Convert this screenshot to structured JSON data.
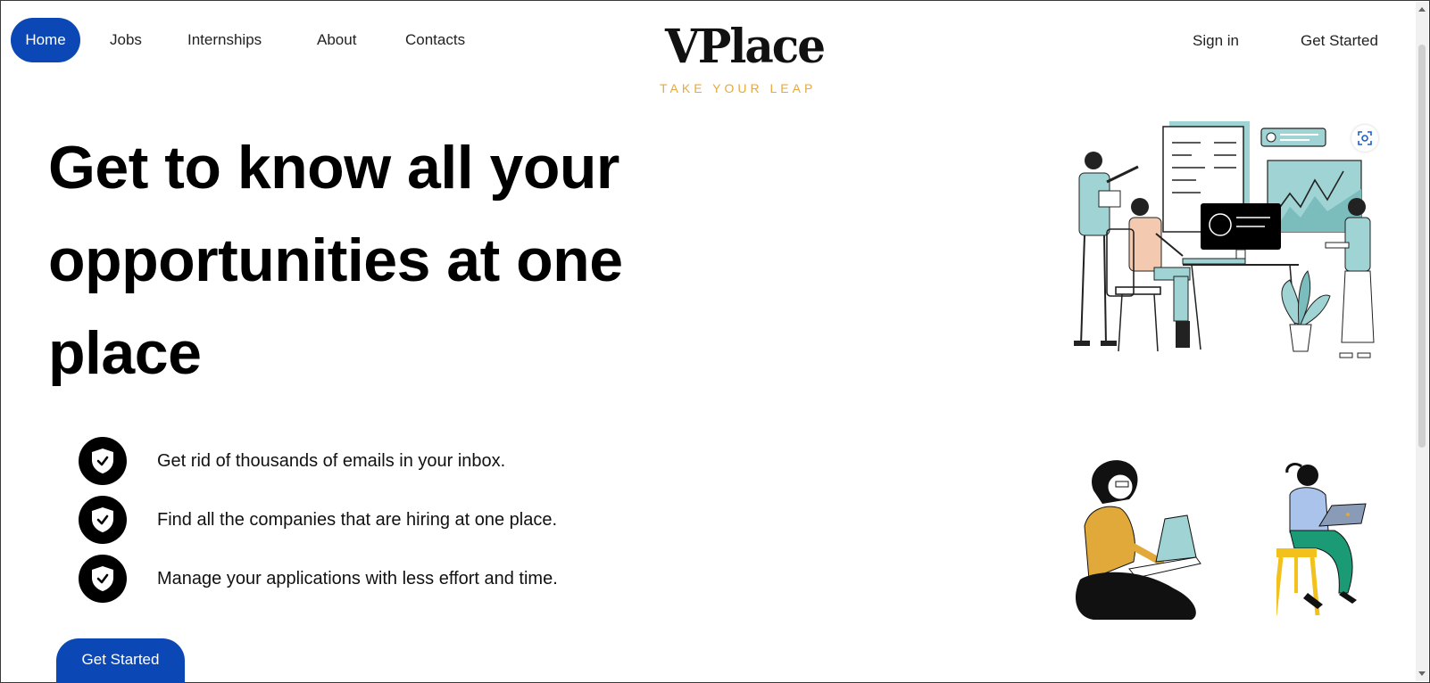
{
  "nav": {
    "home": "Home",
    "jobs": "Jobs",
    "internships": "Internships",
    "about": "About",
    "contacts": "Contacts"
  },
  "brand": {
    "name": "VPlace",
    "tagline": "TAKE YOUR LEAP",
    "tagline_color": "#e8a93a"
  },
  "auth": {
    "sign_in": "Sign in",
    "get_started": "Get Started"
  },
  "hero": {
    "line1": "Get to know all your",
    "line2": "opportunities at one",
    "line3": "place"
  },
  "features": [
    {
      "icon": "shield-check-icon",
      "text": "Get rid of thousands of emails in your inbox."
    },
    {
      "icon": "shield-check-icon",
      "text": "Find all the companies that are hiring at one place."
    },
    {
      "icon": "shield-check-icon",
      "text": "Manage your applications with less effort and time."
    }
  ],
  "cta": {
    "label": "Get Started"
  },
  "colors": {
    "accent": "#0b47b5",
    "teal": "#9fd3d4",
    "mustard": "#e0a93a"
  }
}
